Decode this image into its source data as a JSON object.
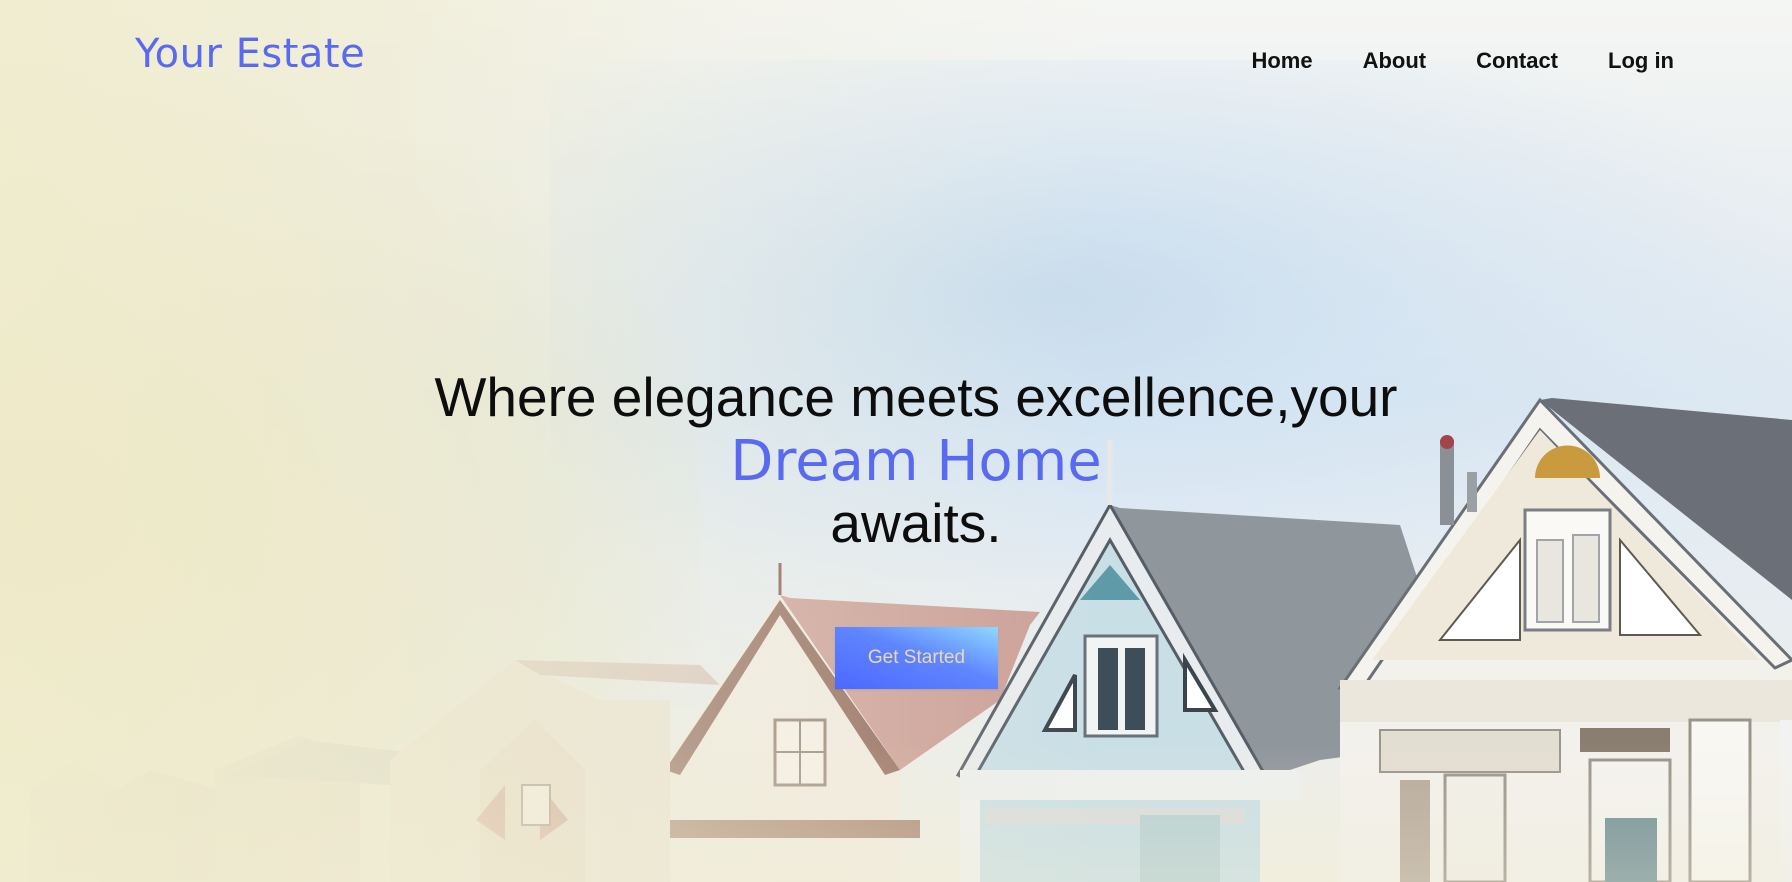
{
  "brand": {
    "name": "Your Estate"
  },
  "nav": {
    "items": [
      {
        "label": "Home"
      },
      {
        "label": "About"
      },
      {
        "label": "Contact"
      },
      {
        "label": "Log in"
      }
    ]
  },
  "hero": {
    "line1": "Where elegance meets excellence,your",
    "highlight": "Dream Home",
    "line3": "awaits.",
    "cta_label": "Get Started"
  },
  "colors": {
    "accent": "#5a6af0",
    "text": "#0d0d0d",
    "cta_gradient_start": "#4d68ff",
    "cta_gradient_end": "#8fd8ff",
    "cta_text": "#e9d9a8"
  }
}
